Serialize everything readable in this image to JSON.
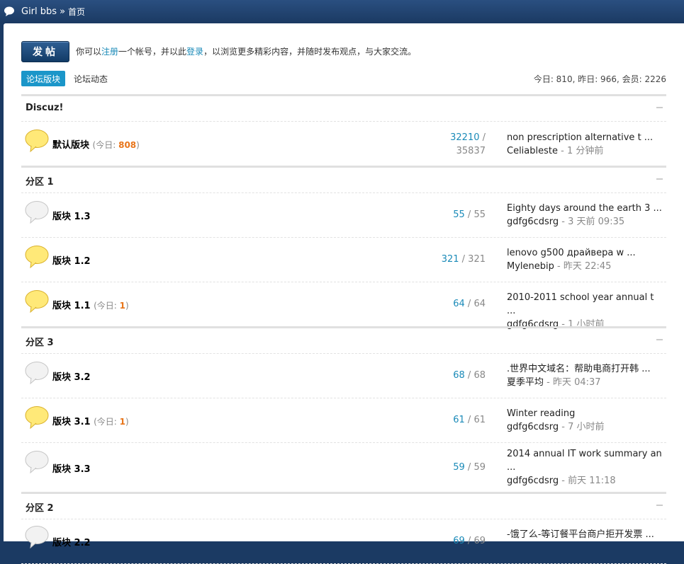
{
  "breadcrumb": {
    "site": "Girl bbs",
    "separator": "»",
    "current": "首页"
  },
  "post_button": "发帖",
  "notice": {
    "pre": "你可以",
    "register": "注册",
    "mid": "一个帐号，并以此",
    "login": "登录",
    "post": "，以浏览更多精彩内容，并随时发布观点，与大家交流。"
  },
  "tabs": {
    "forums": "论坛版块",
    "feed": "论坛动态"
  },
  "stats": "今日: 810, 昨日: 966, 会员: 2226",
  "groups": [
    {
      "name": "Discuz!",
      "forums": [
        {
          "name": "默认版块",
          "today_label": "今日: ",
          "today": "808",
          "threads": "32210",
          "posts": "35837",
          "last_title": "non prescription alternative t ...",
          "last_user": "Celiableste",
          "last_time": " - 1 分钟前",
          "new": true
        }
      ]
    },
    {
      "name": "分区 1",
      "forums": [
        {
          "name": "版块 1.3",
          "threads": "55",
          "posts": "55",
          "last_title": "Eighty days around the earth 3 ...",
          "last_user": "gdfg6cdsrg",
          "last_time": " - 3 天前 09:35",
          "new": false
        },
        {
          "name": "版块 1.2",
          "threads": "321",
          "posts": "321",
          "last_title": "lenovo g500 драйвера w ...",
          "last_user": "Mylenebip",
          "last_time": " - 昨天 22:45",
          "new": true
        },
        {
          "name": "版块 1.1",
          "today_label": "今日: ",
          "today": "1",
          "threads": "64",
          "posts": "64",
          "last_title": "2010-2011 school year annual t ...",
          "last_user": "gdfg6cdsrg",
          "last_time": " - 1 小时前",
          "new": true
        }
      ]
    },
    {
      "name": "分区 3",
      "forums": [
        {
          "name": "版块 3.2",
          "threads": "68",
          "posts": "68",
          "last_title": ".世界中文域名：帮助电商打开韩 ...",
          "last_user": "夏季平均",
          "last_time": " - 昨天 04:37",
          "new": false
        },
        {
          "name": "版块 3.1",
          "today_label": "今日: ",
          "today": "1",
          "threads": "61",
          "posts": "61",
          "last_title": "Winter reading",
          "last_user": "gdfg6cdsrg",
          "last_time": " - 7 小时前",
          "new": true
        },
        {
          "name": "版块 3.3",
          "threads": "59",
          "posts": "59",
          "last_title": "2014 annual IT work summary an ...",
          "last_user": "gdfg6cdsrg",
          "last_time": " - 前天 11:18",
          "new": false
        }
      ]
    },
    {
      "name": "分区 2",
      "forums": [
        {
          "name": "版块 2.2",
          "threads": "69",
          "posts": "69",
          "last_title": "-饿了么-等订餐平台商户拒开发票 ...",
          "last_user": "",
          "last_time": "",
          "new": false
        }
      ]
    }
  ]
}
